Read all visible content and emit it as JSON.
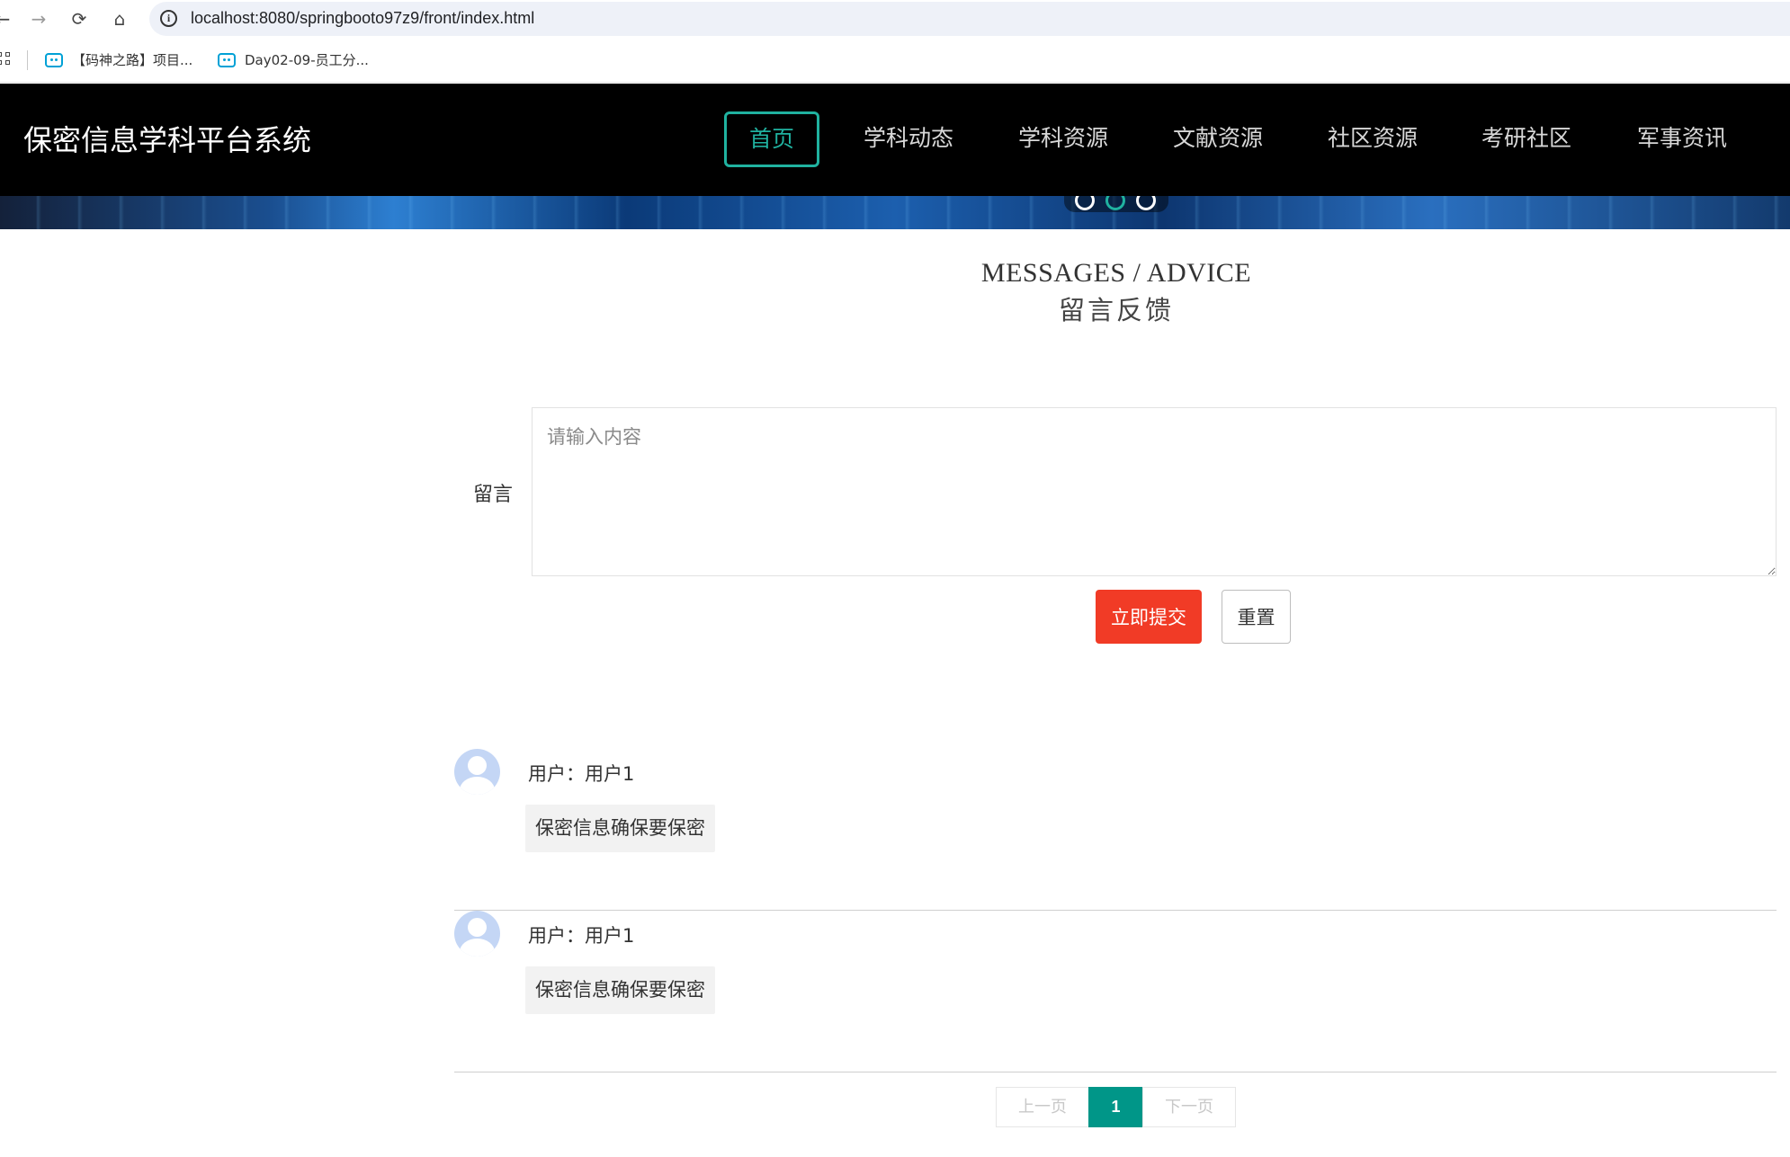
{
  "browser": {
    "url": "localhost:8080/springbooto97z9/front/index.html",
    "bookmarks": [
      {
        "label": "【码神之路】项目..."
      },
      {
        "label": "Day02-09-员工分..."
      }
    ]
  },
  "header": {
    "site_title": "保密信息学科平台系统",
    "nav": [
      {
        "label": "首页",
        "active": true
      },
      {
        "label": "学科动态"
      },
      {
        "label": "学科资源"
      },
      {
        "label": "文献资源"
      },
      {
        "label": "社区资源"
      },
      {
        "label": "考研社区"
      },
      {
        "label": "军事资讯"
      }
    ],
    "accent_color": "#20b2a0"
  },
  "section": {
    "title_en": "MESSAGES / ADVICE",
    "title_cn": "留言反馈"
  },
  "form": {
    "label": "留言",
    "placeholder": "请输入内容",
    "value": "",
    "submit_label": "立即提交",
    "reset_label": "重置",
    "submit_color": "#f13b26"
  },
  "comments": [
    {
      "user": "用户：用户1",
      "content": "保密信息确保要保密"
    },
    {
      "user": "用户：用户1",
      "content": "保密信息确保要保密"
    }
  ],
  "pagination": {
    "prev_label": "上一页",
    "current": "1",
    "next_label": "下一页",
    "current_color": "#009688"
  }
}
